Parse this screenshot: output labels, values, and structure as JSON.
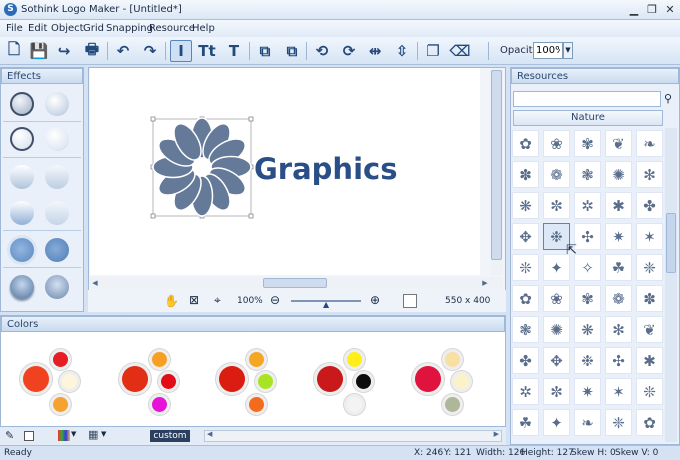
{
  "window": {
    "title": "Sothink Logo Maker - [Untitled*]",
    "app_icon_letter": "S"
  },
  "menu": [
    "File",
    "Edit",
    "Object",
    "Grid",
    "Snapping",
    "Resource",
    "Help"
  ],
  "toolbar": {
    "buttons": [
      {
        "name": "new-icon",
        "glyph": "🗋"
      },
      {
        "name": "save-icon",
        "glyph": "💾"
      },
      {
        "name": "open-icon",
        "glyph": "↪"
      },
      {
        "name": "print-icon",
        "glyph": "🖶"
      },
      {
        "name": "undo-icon",
        "glyph": "↶"
      },
      {
        "name": "redo-icon",
        "glyph": "↷"
      },
      {
        "name": "text-box-icon",
        "glyph": "Ⅰ"
      },
      {
        "name": "text-icon",
        "glyph": "Tt"
      },
      {
        "name": "art-text-icon",
        "glyph": "T"
      },
      {
        "name": "bring-front-icon",
        "glyph": "⧉"
      },
      {
        "name": "send-back-icon",
        "glyph": "⧉"
      },
      {
        "name": "rotate-left-icon",
        "glyph": "⟲"
      },
      {
        "name": "rotate-right-icon",
        "glyph": "⟳"
      },
      {
        "name": "flip-horizontal-icon",
        "glyph": "⇹"
      },
      {
        "name": "flip-vertical-icon",
        "glyph": "⇳"
      },
      {
        "name": "copy-icon",
        "glyph": "❐"
      },
      {
        "name": "clear-icon",
        "glyph": "⌫"
      }
    ],
    "opacity_label": "Opacity:",
    "opacity_value": "100%"
  },
  "effects": {
    "title": "Effects"
  },
  "canvas": {
    "logo_text": "Graphics",
    "logo_color": "#2a4f86",
    "flower_color": "#647a98",
    "zoom": "100%",
    "size": "550 x 400"
  },
  "colors": {
    "title": "Colors",
    "combos": [
      {
        "main": "#f1421f",
        "a": "#e51e26",
        "b": "#fdf6dc",
        "c": "#f6a233"
      },
      {
        "main": "#e12e15",
        "a": "#f6a023",
        "b": "#e20d16",
        "c": "#e713d8"
      },
      {
        "main": "#db1c10",
        "a": "#f5a623",
        "b": "#a9e424",
        "c": "#f36b1d"
      },
      {
        "main": "#c9191b",
        "a": "#ffee1a",
        "b": "#0d0d0d",
        "c": "#f3f3f3"
      },
      {
        "main": "#e0133f",
        "a": "#f8e0a2",
        "b": "#fbf2c8",
        "c": "#aeb79a"
      }
    ],
    "custom_label": "custom"
  },
  "resources": {
    "title": "Resources",
    "category": "Nature",
    "icons": [
      "✿",
      "❀",
      "✾",
      "❦",
      "❧",
      "✽",
      "❁",
      "❃",
      "✺",
      "✻",
      "❋",
      "✼",
      "✲",
      "✱",
      "✤",
      "✥",
      "❉",
      "✣",
      "✷",
      "✶",
      "❊",
      "✦",
      "✧",
      "☘",
      "❈",
      "✿",
      "❀",
      "✾",
      "❁",
      "✽",
      "❃",
      "✺",
      "❋",
      "✻",
      "❦",
      "✤",
      "✥",
      "❉",
      "✣",
      "✱",
      "✲",
      "✼",
      "✷",
      "✶",
      "❊",
      "☘",
      "✦",
      "❧",
      "❈",
      "✿"
    ]
  },
  "status": {
    "ready": "Ready",
    "x": "X: 246",
    "y": "Y: 121",
    "width": "Width: 126",
    "height": "Height: 127",
    "skew_h": "Skew H: 0",
    "skew_v": "Skew V: 0"
  }
}
